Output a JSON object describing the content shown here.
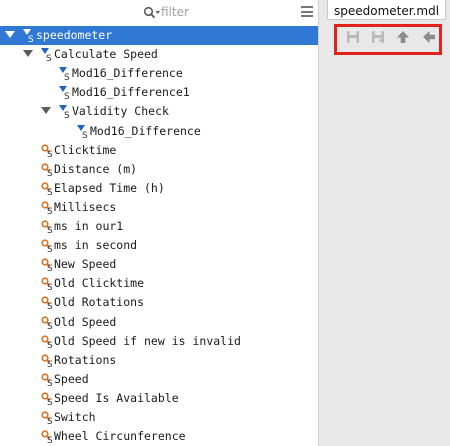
{
  "filter": {
    "placeholder": "filter"
  },
  "tab": {
    "label": "speedometer.mdl"
  },
  "colors": {
    "selection": "#2f78d3",
    "subsystem_icon": "#1e63c6",
    "signal_icon": "#e0701e",
    "highlight": "#e2221c"
  },
  "tree": [
    {
      "label": "speedometer",
      "icon": "subsystem",
      "expanded": true,
      "selected": true
    },
    {
      "label": "Calculate Speed",
      "icon": "subsystem",
      "expanded": true
    },
    {
      "label": "Mod16_Difference",
      "icon": "subsystem"
    },
    {
      "label": "Mod16_Difference1",
      "icon": "subsystem"
    },
    {
      "label": "Validity Check",
      "icon": "subsystem",
      "expanded": true
    },
    {
      "label": "Mod16_Difference",
      "icon": "subsystem"
    },
    {
      "label": "Clicktime",
      "icon": "signal"
    },
    {
      "label": "Distance (m)",
      "icon": "signal"
    },
    {
      "label": "Elapsed Time (h)",
      "icon": "signal"
    },
    {
      "label": "Millisecs",
      "icon": "signal"
    },
    {
      "label": "ms in our1",
      "icon": "signal"
    },
    {
      "label": "ms in second",
      "icon": "signal"
    },
    {
      "label": "New Speed",
      "icon": "signal"
    },
    {
      "label": "Old Clicktime",
      "icon": "signal"
    },
    {
      "label": "Old Rotations",
      "icon": "signal"
    },
    {
      "label": "Old Speed",
      "icon": "signal"
    },
    {
      "label": "Old Speed if new is invalid",
      "icon": "signal"
    },
    {
      "label": "Rotations",
      "icon": "signal"
    },
    {
      "label": "Speed",
      "icon": "signal"
    },
    {
      "label": "Speed Is Available",
      "icon": "signal"
    },
    {
      "label": "Switch",
      "icon": "signal"
    },
    {
      "label": "Wheel Circunference",
      "icon": "signal"
    }
  ],
  "toolbar": {
    "buttons": [
      {
        "name": "save-icon",
        "enabled": false
      },
      {
        "name": "save-all-icon",
        "enabled": false
      },
      {
        "name": "arrow-up-icon",
        "enabled": true
      },
      {
        "name": "arrow-left-icon",
        "enabled": true
      }
    ]
  }
}
